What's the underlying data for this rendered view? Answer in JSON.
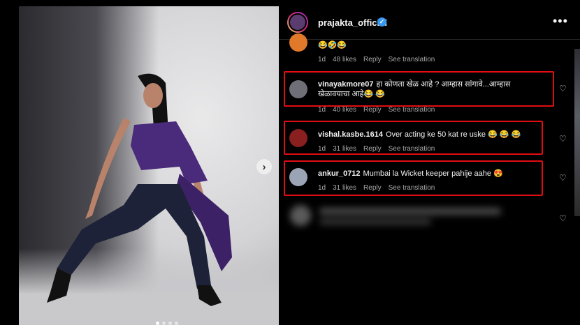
{
  "post": {
    "image_description_alt": "",
    "carousel": {
      "total": 4,
      "active": 0
    }
  },
  "header": {
    "username": "prajakta_official",
    "more_label": "•••"
  },
  "comments": [
    {
      "username": "",
      "text": "😂🤣😂",
      "time": "1d",
      "likes": "48 likes",
      "reply": "Reply",
      "translate": "See translation",
      "highlighted": false
    },
    {
      "username": "vinayakmore07",
      "text": "हा कोणता खेळ आहे ? आम्हास सांगावे...आम्हास खेळावयाचा आहे😂 😂",
      "time": "1d",
      "likes": "40 likes",
      "reply": "Reply",
      "translate": "See translation",
      "highlighted": true
    },
    {
      "username": "vishal.kasbe.1614",
      "text": "Over acting ke 50 kat re uske 😂 😂 😂",
      "time": "1d",
      "likes": "31 likes",
      "reply": "Reply",
      "translate": "See translation",
      "highlighted": true
    },
    {
      "username": "ankur_0712",
      "text": "Mumbai la Wicket keeper pahije aahe 😍",
      "time": "1d",
      "likes": "31 likes",
      "reply": "Reply",
      "translate": "See translation",
      "highlighted": true
    }
  ],
  "colors": {
    "highlight": "#e10d14",
    "verified": "#3897f0",
    "background": "#000000"
  },
  "icons": {
    "heart": "heart-icon",
    "verified": "verified-badge-icon",
    "next": "chevron-right-icon"
  }
}
